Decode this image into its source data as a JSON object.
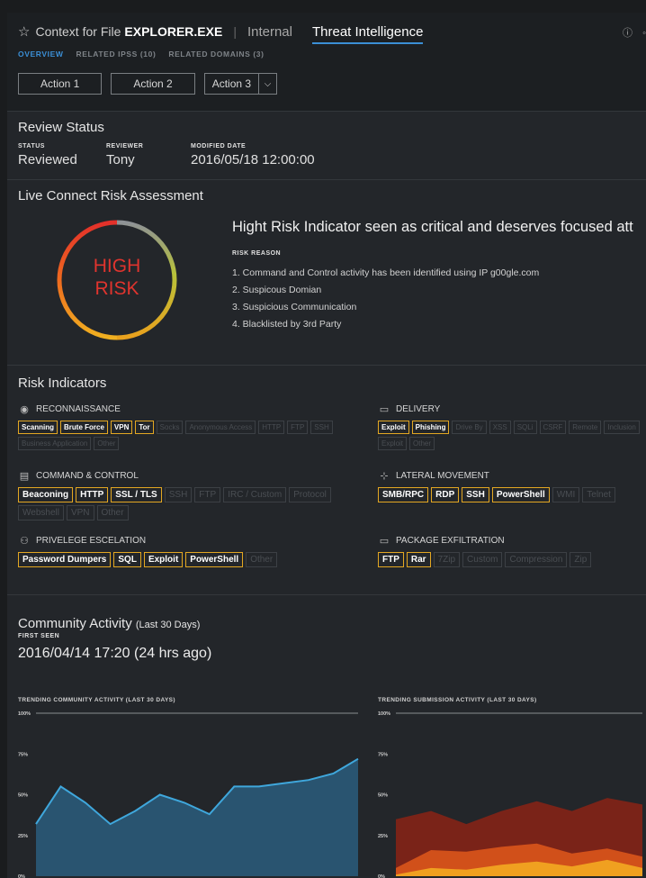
{
  "header": {
    "context_label": "Context for File",
    "file_name": "EXPLORER.EXE",
    "tabs": [
      {
        "label": "Internal"
      },
      {
        "label": "Threat Intelligence"
      }
    ],
    "subtabs": [
      {
        "label": "OVERVIEW"
      },
      {
        "label": "RELATED IPSS (10)"
      },
      {
        "label": "RELATED DOMAINS (3)"
      }
    ],
    "actions": [
      "Action 1",
      "Action 2",
      "Action 3"
    ]
  },
  "review": {
    "title": "Review Status",
    "status_label": "STATUS",
    "status": "Reviewed",
    "reviewer_label": "REVIEWER",
    "reviewer": "Tony",
    "modified_label": "MODIFIED DATE",
    "modified": "2016/05/18 12:00:00"
  },
  "risk": {
    "title": "Live Connect Risk Assessment",
    "level_line1": "HIGH",
    "level_line2": "RISK",
    "headline": "Hight Risk Indicator seen as critical and deserves focused att",
    "reason_label": "RISK REASON",
    "reasons": [
      "1. Command and Control activity has been identified using IP g00gle.com",
      "2. Suspicous Domian",
      "3. Suspicious Communication",
      "4. Blacklisted by 3rd Party"
    ]
  },
  "indicators": {
    "title": "Risk Indicators",
    "categories": [
      {
        "name": "RECONNAISSANCE",
        "icon": "globe-icon",
        "tags": [
          {
            "label": "Scanning",
            "on": true
          },
          {
            "label": "Brute Force",
            "on": true
          },
          {
            "label": "VPN",
            "on": true
          },
          {
            "label": "Tor",
            "on": true
          },
          {
            "label": "Socks",
            "on": false
          },
          {
            "label": "Anonymous Access",
            "on": false
          },
          {
            "label": "HTTP",
            "on": false
          },
          {
            "label": "FTP",
            "on": false
          },
          {
            "label": "SSH",
            "on": false
          },
          {
            "label": "Business Application",
            "on": false
          },
          {
            "label": "Other",
            "on": false
          }
        ]
      },
      {
        "name": "DELIVERY",
        "icon": "package-icon",
        "tags": [
          {
            "label": "Exploit",
            "on": true
          },
          {
            "label": "Phishing",
            "on": true
          },
          {
            "label": "Drive By",
            "on": false
          },
          {
            "label": "XSS",
            "on": false
          },
          {
            "label": "SQLi",
            "on": false
          },
          {
            "label": "CSRF",
            "on": false
          },
          {
            "label": "Remote",
            "on": false
          },
          {
            "label": "Inclusion",
            "on": false
          },
          {
            "label": "Exploit",
            "on": false
          },
          {
            "label": "Other",
            "on": false
          }
        ]
      },
      {
        "name": "COMMAND & CONTROL",
        "icon": "server-icon",
        "tags": [
          {
            "label": "Beaconing",
            "on": true
          },
          {
            "label": "HTTP",
            "on": true
          },
          {
            "label": "SSL / TLS",
            "on": true
          },
          {
            "label": "SSH",
            "on": false
          },
          {
            "label": "FTP",
            "on": false
          },
          {
            "label": "IRC / Custom",
            "on": false
          },
          {
            "label": "Protocol",
            "on": false
          },
          {
            "label": "Webshell",
            "on": false
          },
          {
            "label": "VPN",
            "on": false
          },
          {
            "label": "Other",
            "on": false
          }
        ]
      },
      {
        "name": "LATERAL MOVEMENT",
        "icon": "network-icon",
        "tags": [
          {
            "label": "SMB/RPC",
            "on": true
          },
          {
            "label": "RDP",
            "on": true
          },
          {
            "label": "SSH",
            "on": true
          },
          {
            "label": "PowerShell",
            "on": true
          },
          {
            "label": "WMI",
            "on": false
          },
          {
            "label": "Telnet",
            "on": false
          }
        ]
      },
      {
        "name": "PRIVELEGE ESCELATION",
        "icon": "user-icon",
        "tags": [
          {
            "label": "Password Dumpers",
            "on": true
          },
          {
            "label": "SQL",
            "on": true
          },
          {
            "label": "Exploit",
            "on": true
          },
          {
            "label": "PowerShell",
            "on": true
          },
          {
            "label": "Other",
            "on": false
          }
        ]
      },
      {
        "name": "PACKAGE EXFILTRATION",
        "icon": "box-icon",
        "tags": [
          {
            "label": "FTP",
            "on": true
          },
          {
            "label": "Rar",
            "on": true
          },
          {
            "label": "7Zip",
            "on": false
          },
          {
            "label": "Custom",
            "on": false
          },
          {
            "label": "Compression",
            "on": false
          },
          {
            "label": "Zip",
            "on": false
          }
        ]
      }
    ]
  },
  "community": {
    "title": "Community Activity",
    "title_suffix": "(Last 30 Days)",
    "first_seen_label": "FIRST SEEN",
    "first_seen": "2016/04/14 17:20  (24 hrs ago)"
  },
  "chart_data": [
    {
      "type": "area",
      "title": "TRENDING COMMUNITY ACTIVITY (LAST 30 DAYS)",
      "ytick_labels": [
        "100%",
        "75%",
        "50%",
        "25%",
        "0%"
      ],
      "ylim": [
        0,
        100
      ],
      "series": [
        {
          "values": [
            32,
            55,
            45,
            32,
            40,
            50,
            45,
            38,
            55,
            55,
            57,
            59,
            63,
            72
          ],
          "color": "#2a5d7c"
        }
      ]
    },
    {
      "type": "area",
      "title": "TRENDING SUBMISSION ACTIVITY (LAST 30 DAYS)",
      "ytick_labels": [
        "100%",
        "75%",
        "50%",
        "25%",
        "0%"
      ],
      "ylim": [
        0,
        100
      ],
      "series": [
        {
          "values": [
            35,
            40,
            32,
            40,
            46,
            40,
            48,
            44
          ],
          "color": "#7a2318"
        },
        {
          "values": [
            5,
            16,
            15,
            18,
            20,
            14,
            17,
            12
          ],
          "color": "#d1501a"
        },
        {
          "values": [
            1,
            5,
            4,
            7,
            9,
            6,
            10,
            5
          ],
          "color": "#f0a020"
        }
      ]
    }
  ]
}
